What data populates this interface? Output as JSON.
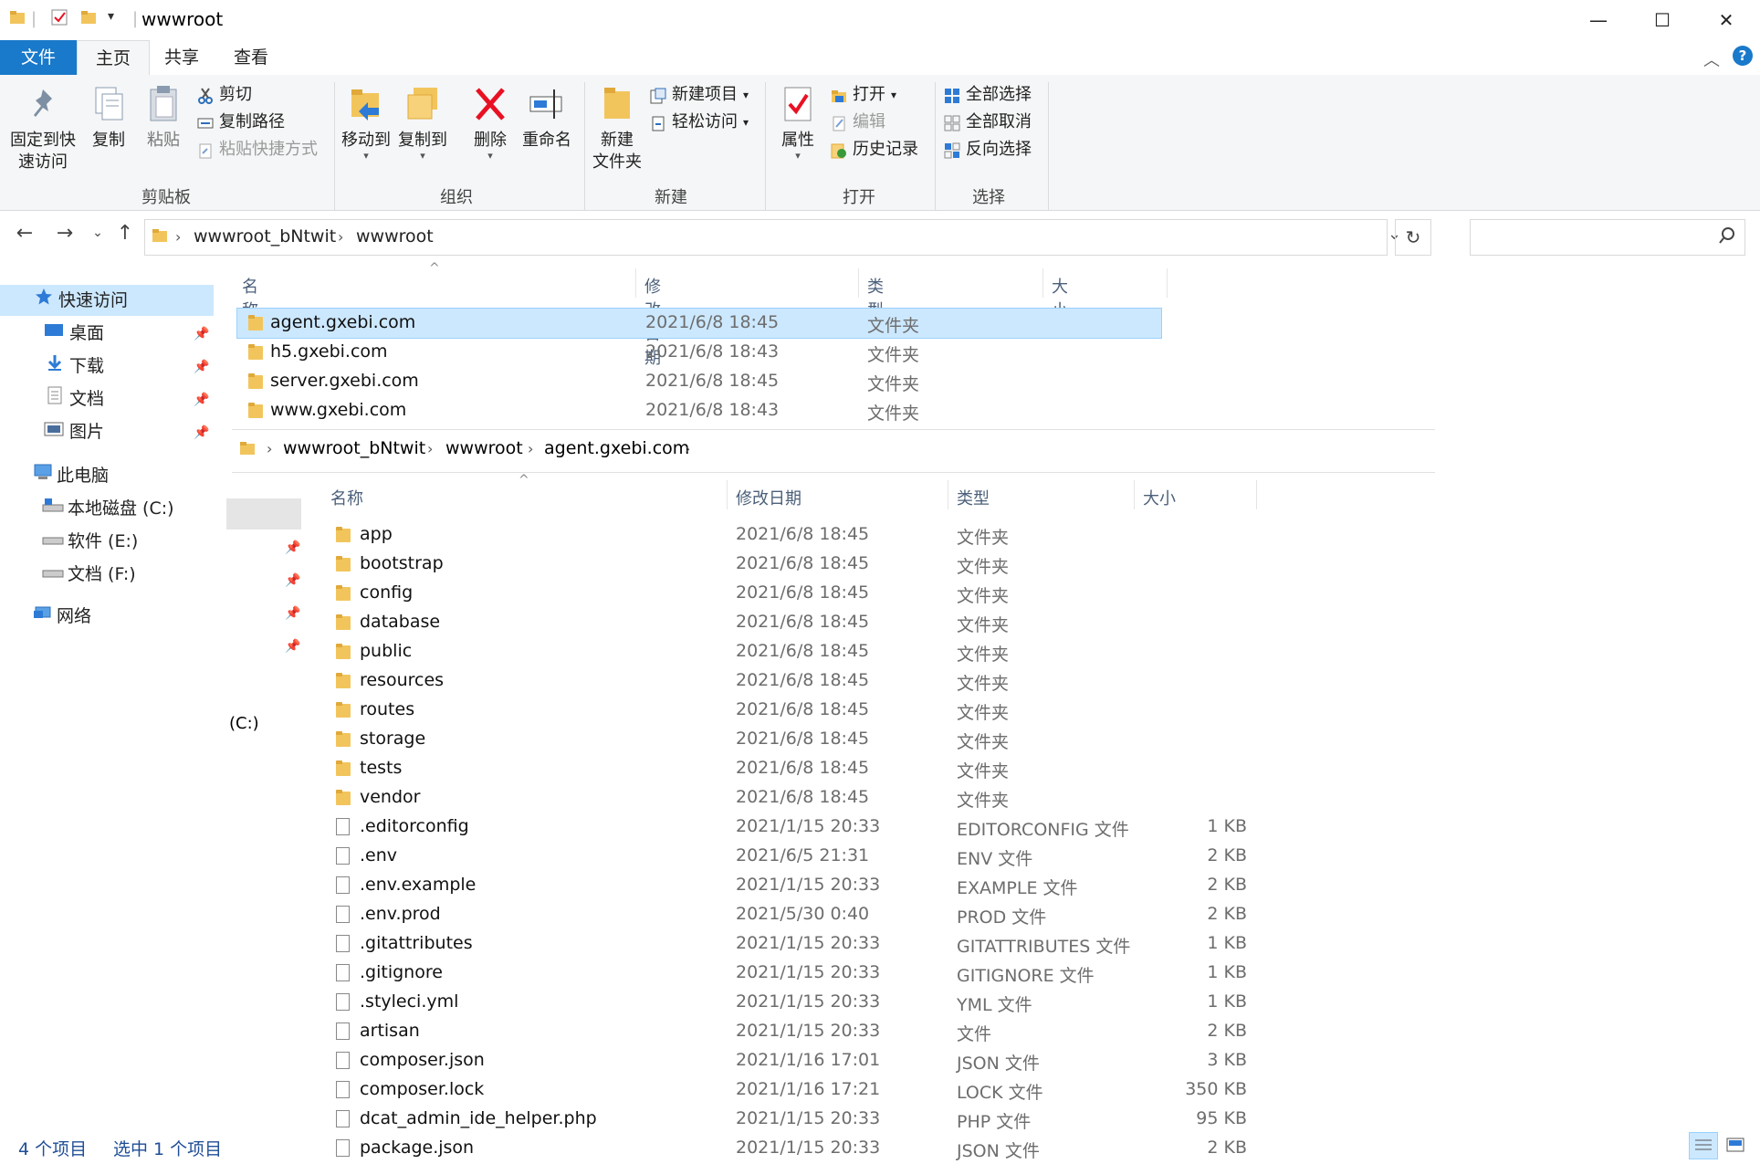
{
  "title": "wwwroot",
  "ribbon_tabs": [
    "文件",
    "主页",
    "共享",
    "查看"
  ],
  "ribbon": {
    "clipboard": {
      "pin": "固定到快\n速访问",
      "copy": "复制",
      "paste": "粘贴",
      "cut": "剪切",
      "copy_path": "复制路径",
      "paste_shortcut": "粘贴快捷方式",
      "label": "剪贴板"
    },
    "organize": {
      "move_to": "移动到",
      "copy_to": "复制到",
      "delete": "删除",
      "rename": "重命名",
      "label": "组织"
    },
    "new": {
      "new_folder": "新建\n文件夹",
      "new_item": "新建项目",
      "easy_access": "轻松访问",
      "label": "新建"
    },
    "open": {
      "properties": "属性",
      "open": "打开",
      "edit": "编辑",
      "history": "历史记录",
      "label": "打开"
    },
    "select": {
      "select_all": "全部选择",
      "select_none": "全部取消",
      "invert": "反向选择",
      "label": "选择"
    }
  },
  "address": {
    "crumbs": [
      "wwwroot_bNtwit",
      "wwwroot"
    ]
  },
  "nav": {
    "quick_access": "快速访问",
    "items": [
      "桌面",
      "下载",
      "文档",
      "图片"
    ],
    "this_pc": "此电脑",
    "drives": [
      "本地磁盘 (C:)",
      "软件 (E:)",
      "文档 (F:)"
    ],
    "network": "网络"
  },
  "columns": {
    "name": "名称",
    "date": "修改日期",
    "type": "类型",
    "size": "大小"
  },
  "top_files": [
    {
      "name": "agent.gxebi.com",
      "date": "2021/6/8 18:45",
      "type": "文件夹",
      "size": "",
      "selected": true
    },
    {
      "name": "h5.gxebi.com",
      "date": "2021/6/8 18:43",
      "type": "文件夹",
      "size": ""
    },
    {
      "name": "server.gxebi.com",
      "date": "2021/6/8 18:45",
      "type": "文件夹",
      "size": ""
    },
    {
      "name": "www.gxebi.com",
      "date": "2021/6/8 18:43",
      "type": "文件夹",
      "size": ""
    }
  ],
  "overlay": {
    "crumbs": [
      "wwwroot_bNtwit",
      "wwwroot",
      "agent.gxebi.com"
    ],
    "side_label": "(C:)",
    "files": [
      {
        "name": "app",
        "date": "2021/6/8 18:45",
        "type": "文件夹",
        "size": "",
        "folder": true
      },
      {
        "name": "bootstrap",
        "date": "2021/6/8 18:45",
        "type": "文件夹",
        "size": "",
        "folder": true
      },
      {
        "name": "config",
        "date": "2021/6/8 18:45",
        "type": "文件夹",
        "size": "",
        "folder": true
      },
      {
        "name": "database",
        "date": "2021/6/8 18:45",
        "type": "文件夹",
        "size": "",
        "folder": true
      },
      {
        "name": "public",
        "date": "2021/6/8 18:45",
        "type": "文件夹",
        "size": "",
        "folder": true
      },
      {
        "name": "resources",
        "date": "2021/6/8 18:45",
        "type": "文件夹",
        "size": "",
        "folder": true
      },
      {
        "name": "routes",
        "date": "2021/6/8 18:45",
        "type": "文件夹",
        "size": "",
        "folder": true
      },
      {
        "name": "storage",
        "date": "2021/6/8 18:45",
        "type": "文件夹",
        "size": "",
        "folder": true
      },
      {
        "name": "tests",
        "date": "2021/6/8 18:45",
        "type": "文件夹",
        "size": "",
        "folder": true
      },
      {
        "name": "vendor",
        "date": "2021/6/8 18:45",
        "type": "文件夹",
        "size": "",
        "folder": true
      },
      {
        "name": ".editorconfig",
        "date": "2021/1/15 20:33",
        "type": "EDITORCONFIG 文件",
        "size": "1 KB"
      },
      {
        "name": ".env",
        "date": "2021/6/5 21:31",
        "type": "ENV 文件",
        "size": "2 KB"
      },
      {
        "name": ".env.example",
        "date": "2021/1/15 20:33",
        "type": "EXAMPLE 文件",
        "size": "2 KB"
      },
      {
        "name": ".env.prod",
        "date": "2021/5/30 0:40",
        "type": "PROD 文件",
        "size": "2 KB"
      },
      {
        "name": ".gitattributes",
        "date": "2021/1/15 20:33",
        "type": "GITATTRIBUTES 文件",
        "size": "1 KB"
      },
      {
        "name": ".gitignore",
        "date": "2021/1/15 20:33",
        "type": "GITIGNORE 文件",
        "size": "1 KB"
      },
      {
        "name": ".styleci.yml",
        "date": "2021/1/15 20:33",
        "type": "YML 文件",
        "size": "1 KB"
      },
      {
        "name": "artisan",
        "date": "2021/1/15 20:33",
        "type": "文件",
        "size": "2 KB"
      },
      {
        "name": "composer.json",
        "date": "2021/1/16 17:01",
        "type": "JSON 文件",
        "size": "3 KB"
      },
      {
        "name": "composer.lock",
        "date": "2021/1/16 17:21",
        "type": "LOCK 文件",
        "size": "350 KB"
      },
      {
        "name": "dcat_admin_ide_helper.php",
        "date": "2021/1/15 20:33",
        "type": "PHP 文件",
        "size": "95 KB"
      },
      {
        "name": "package.json",
        "date": "2021/1/15 20:33",
        "type": "JSON 文件",
        "size": "2 KB"
      }
    ]
  },
  "status": {
    "count": "4 个项目",
    "selected": "选中 1 个项目"
  },
  "colors": {
    "accent": "#1979ca",
    "selection": "#cce8ff",
    "folder": "#f2c55c",
    "delete_red": "#e81123"
  }
}
